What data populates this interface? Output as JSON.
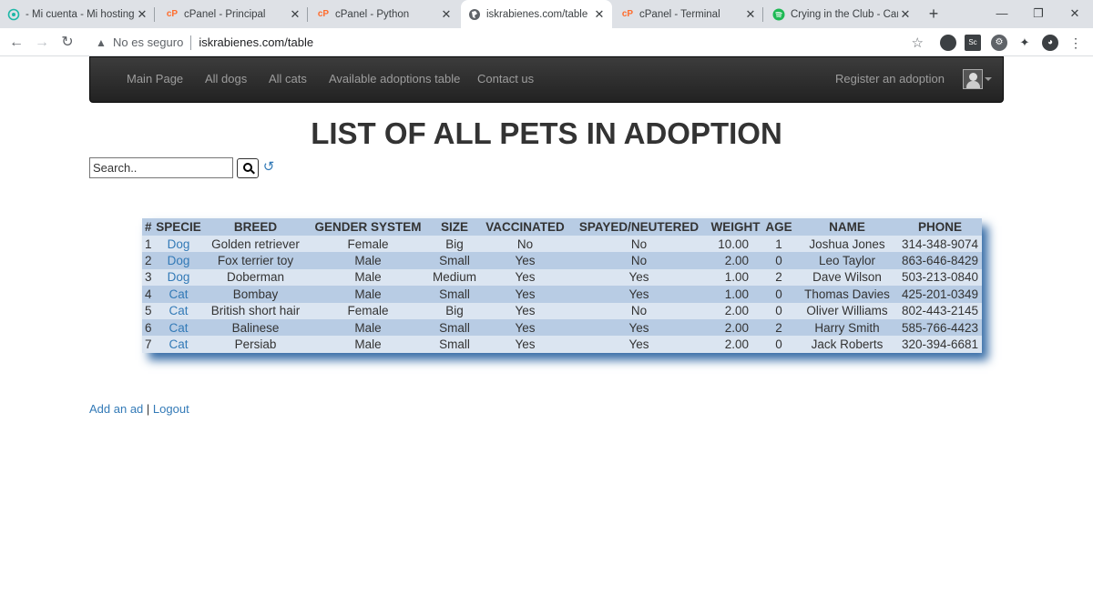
{
  "browser": {
    "tabs": [
      {
        "title": "- Mi cuenta - Mi hosting",
        "icon": "hosting-logo-icon"
      },
      {
        "title": "cPanel - Principal",
        "icon": "cpanel-icon"
      },
      {
        "title": "cPanel - Python",
        "icon": "cpanel-icon"
      },
      {
        "title": "iskrabienes.com/table",
        "icon": "globe-icon"
      },
      {
        "title": "cPanel - Terminal",
        "icon": "cpanel-icon"
      },
      {
        "title": "Crying in the Club - Cam",
        "icon": "spotify-icon"
      }
    ],
    "security_label": "No es seguro",
    "url": "iskrabienes.com/table",
    "accent": "#337ab7"
  },
  "navbar": {
    "links": [
      "Main Page",
      "All dogs",
      "All cats",
      "Available adoptions table",
      "Contact us"
    ],
    "register": "Register an adoption"
  },
  "page": {
    "title": "LIST OF ALL PETS IN ADOPTION",
    "search_placeholder": "Search.."
  },
  "table": {
    "headers": [
      "#",
      "SPECIE",
      "BREED",
      "GENDER SYSTEM",
      "SIZE",
      "VACCINATED",
      "SPAYED/NEUTERED",
      "WEIGHT",
      "AGE",
      "NAME",
      "PHONE"
    ],
    "rows": [
      [
        "1",
        "Dog",
        "Golden retriever",
        "Female",
        "Big",
        "No",
        "No",
        "10.00",
        "1",
        "Joshua Jones",
        "314-348-9074"
      ],
      [
        "2",
        "Dog",
        "Fox terrier toy",
        "Male",
        "Small",
        "Yes",
        "No",
        "2.00",
        "0",
        "Leo Taylor",
        "863-646-8429"
      ],
      [
        "3",
        "Dog",
        "Doberman",
        "Male",
        "Medium",
        "Yes",
        "Yes",
        "1.00",
        "2",
        "Dave Wilson",
        "503-213-0840"
      ],
      [
        "4",
        "Cat",
        "Bombay",
        "Male",
        "Small",
        "Yes",
        "Yes",
        "1.00",
        "0",
        "Thomas Davies",
        "425-201-0349"
      ],
      [
        "5",
        "Cat",
        "British short hair",
        "Female",
        "Big",
        "Yes",
        "No",
        "2.00",
        "0",
        "Oliver Williams",
        "802-443-2145"
      ],
      [
        "6",
        "Cat",
        "Balinese",
        "Male",
        "Small",
        "Yes",
        "Yes",
        "2.00",
        "2",
        "Harry Smith",
        "585-766-4423"
      ],
      [
        "7",
        "Cat",
        "Persiab",
        "Male",
        "Small",
        "Yes",
        "Yes",
        "2.00",
        "0",
        "Jack Roberts",
        "320-394-6681"
      ]
    ]
  },
  "footer": {
    "add_ad": "Add an ad",
    "separator": "|",
    "logout": "Logout"
  }
}
